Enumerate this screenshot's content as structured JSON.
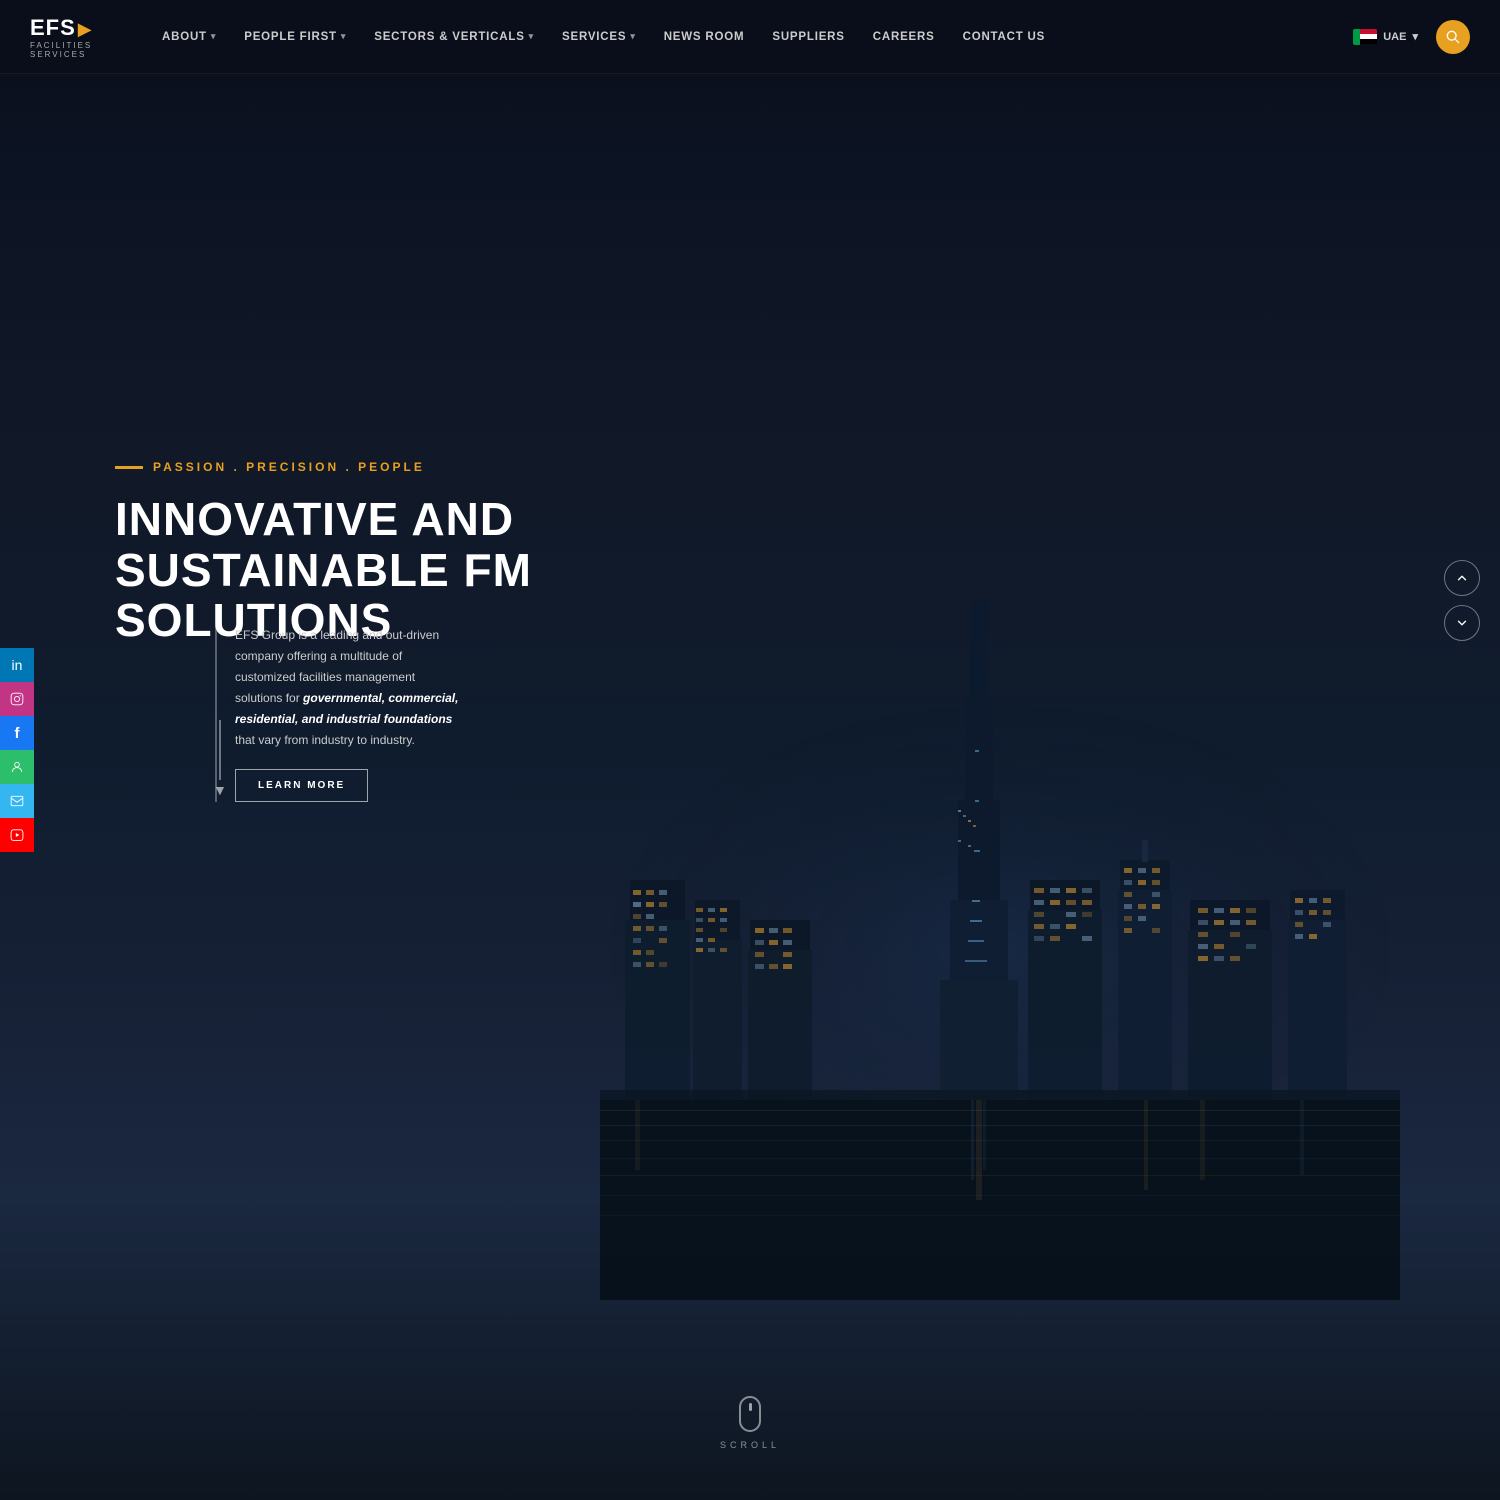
{
  "brand": {
    "logo_text": "EFS",
    "logo_subtitle": "FACILITIES SERVICES",
    "logo_arrow": "▶"
  },
  "nav": {
    "items": [
      {
        "label": "ABOUT",
        "has_dropdown": true
      },
      {
        "label": "PEOPLE FIRST",
        "has_dropdown": true
      },
      {
        "label": "SECTORS & VERTICALS",
        "has_dropdown": true
      },
      {
        "label": "SERVICES",
        "has_dropdown": true
      },
      {
        "label": "NEWS ROOM",
        "has_dropdown": false
      },
      {
        "label": "SUPPLIERS",
        "has_dropdown": false
      },
      {
        "label": "CAREERS",
        "has_dropdown": false
      },
      {
        "label": "CONTACT US",
        "has_dropdown": false
      }
    ],
    "language": "UAE",
    "search_icon": "🔍"
  },
  "social": {
    "items": [
      {
        "label": "LinkedIn",
        "icon": "in"
      },
      {
        "label": "Instagram",
        "icon": "📷"
      },
      {
        "label": "Facebook",
        "icon": "f"
      },
      {
        "label": "Profile",
        "icon": "👤"
      },
      {
        "label": "Email",
        "icon": "✉"
      },
      {
        "label": "YouTube",
        "icon": "▶"
      }
    ]
  },
  "hero": {
    "tagline": "PASSION . PRECISION . PEOPLE",
    "title_line1": "INNOVATIVE AND",
    "title_line2": "SUSTAINABLE FM SOLUTIONS",
    "description": "EFS Group is a leading and out-driven company offering a multitude of customized facilities management solutions for",
    "description_bold": "governmental, commercial, residential, and industrial foundations",
    "description_end": "that vary from industry to industry.",
    "learn_more_label": "LEARN MORE"
  },
  "scroll": {
    "label": "SCROLL"
  },
  "colors": {
    "accent": "#e8a020",
    "primary_bg": "#0a0e1a",
    "text_light": "#ffffff",
    "text_muted": "#cccccc"
  }
}
